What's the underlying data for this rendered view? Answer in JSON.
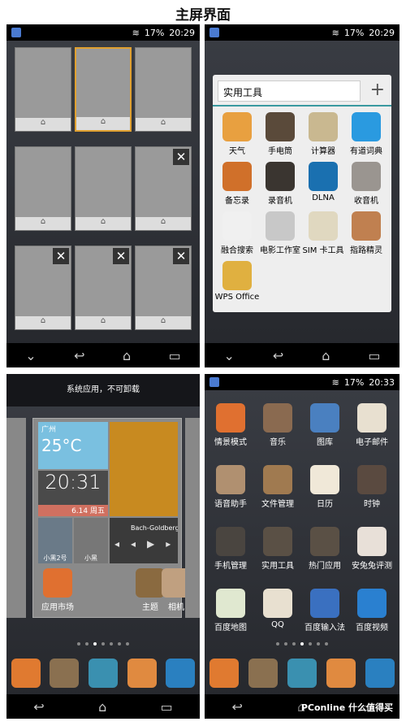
{
  "title": "主屏界面",
  "status_tl": {
    "battery": "17%",
    "time": "20:29"
  },
  "status_tr": {
    "battery": "17%",
    "time": "20:29"
  },
  "status_br": {
    "battery": "17%",
    "time": "20:33"
  },
  "folder": {
    "name": "实用工具",
    "add": "+",
    "apps": [
      {
        "label": "天气",
        "color": "#e8a040"
      },
      {
        "label": "手电筒",
        "color": "#5a4a3a"
      },
      {
        "label": "计算器",
        "color": "#c9b890"
      },
      {
        "label": "有道词典",
        "color": "#2a9ae0"
      },
      {
        "label": "备忘录",
        "color": "#d0702a"
      },
      {
        "label": "录音机",
        "color": "#3a3530"
      },
      {
        "label": "DLNA",
        "color": "#1a70b0"
      },
      {
        "label": "收音机",
        "color": "#9a9590"
      },
      {
        "label": "融合搜索",
        "color": "#f0f0f0"
      },
      {
        "label": "电影工作室",
        "color": "#c8c8c8"
      },
      {
        "label": "SIM 卡工具",
        "color": "#e0d8c0"
      },
      {
        "label": "指路精灵",
        "color": "#c08050"
      },
      {
        "label": "WPS Office",
        "color": "#e0b040"
      }
    ]
  },
  "bl": {
    "notice": "系统应用，不可卸载",
    "weather_city": "广州",
    "weather_temp": "25°C",
    "clock": "20:31",
    "date": "6.14",
    "weekday": "周五",
    "music": "Bach-Goldberg V",
    "photo1": "小黑2号",
    "photo2": "小黑",
    "apps": [
      {
        "label": "应用市场",
        "color": "#e07030"
      },
      {
        "label": "主题",
        "color": "#8a6a40"
      },
      {
        "label": "相机",
        "color": "#c0a080"
      }
    ]
  },
  "br": {
    "apps": [
      {
        "label": "情景模式",
        "color": "#e07030"
      },
      {
        "label": "音乐",
        "color": "#8a6a50"
      },
      {
        "label": "图库",
        "color": "#4a80c0"
      },
      {
        "label": "电子邮件",
        "color": "#e8e0d0"
      },
      {
        "label": "语音助手",
        "color": "#b09070"
      },
      {
        "label": "文件管理",
        "color": "#a07a50"
      },
      {
        "label": "日历",
        "color": "#f0e8d8"
      },
      {
        "label": "时钟",
        "color": "#5a4a40"
      },
      {
        "label": "手机管理",
        "color": "#4a4540"
      },
      {
        "label": "实用工具",
        "color": "#5a5045"
      },
      {
        "label": "热门应用",
        "color": "#5a5045"
      },
      {
        "label": "安兔兔评测",
        "color": "#e8e0d8"
      },
      {
        "label": "百度地图",
        "color": "#e0e8d0"
      },
      {
        "label": "QQ",
        "color": "#e8e0d0"
      },
      {
        "label": "百度输入法",
        "color": "#3a70c0"
      },
      {
        "label": "百度视频",
        "color": "#2a80d0"
      }
    ]
  },
  "dock_colors": [
    "#e07a30",
    "#8a7050",
    "#3a90b0",
    "#e08a40",
    "#2a80c0"
  ],
  "watermark": "PConline 什么值得买"
}
